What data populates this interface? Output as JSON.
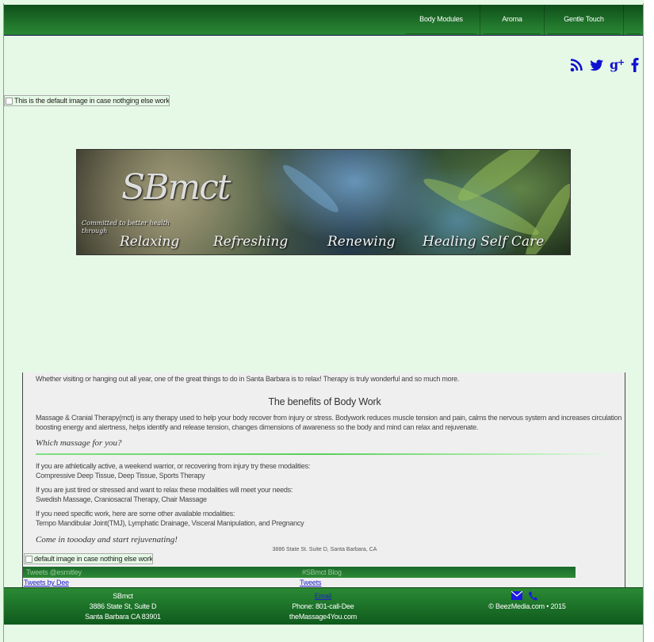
{
  "nav": {
    "items": [
      {
        "label": "Body Modules"
      },
      {
        "label": "Aroma"
      },
      {
        "label": "Gentle Touch"
      },
      {
        "label": ""
      }
    ]
  },
  "social": {
    "icons": [
      "rss-icon",
      "twitter-icon",
      "google-plus-icon",
      "facebook-icon"
    ],
    "color": "#1010d0"
  },
  "default_image_alt": "This is the default image in case nothging else works",
  "banner": {
    "logo": "SBmct",
    "tagline": "Committed to better health through",
    "words": [
      "Relaxing",
      "Refreshing",
      "Renewing",
      "Healing Self Care"
    ]
  },
  "content": {
    "intro": "Whether visiting or hanging out all year, one of the great things to do in Santa Barbara is to relax! Therapy is truly wonderful and so much more.",
    "heading": "The benefits of Body Work",
    "body_line1": "Massage & Cranial Therapy(mct) is any therapy used to help your body recover from injury or stress. Bodywork reduces muscle tension and pain, calms the nervous system and increases circulation",
    "body_line2": "boosting energy and alertness, helps identify and release tension, changes dimensions of awareness so the body and mind can relax and rejuvenate.",
    "subheading": "Which massage for you?",
    "p1_line1": "If you are athletically active, a weekend warrior, or recovering from injury try these modalities:",
    "p1_line2": "Compressive Deep Tissue, Deep Tissue, Sports Therapy",
    "p2_line1": "If you are just tired or stressed and want to relax these modalities will meet your needs:",
    "p2_line2": "Swedish Massage, Craniosacral Therapy, Chair Massage",
    "p3_line1": "If you need specific work, here are some other available modalities:",
    "p3_line2": "Tempo Mandibular Joint(TMJ), Lymphatic Drainage, Visceral Manipulation, and Pregnancy",
    "cta": "Come in toooday and start rejuvenating!",
    "address": "3886 State St. Suite D, Santa Barbara, CA",
    "small_image_alt": "default image in case nothing else works"
  },
  "tweets": {
    "left_title": "Tweets @esmitley",
    "left_link": "Tweets by Dee",
    "right_title": "#SBmct Blog",
    "right_link": "Tweets"
  },
  "footer": {
    "name": "SBmct",
    "street": "3886 State St, Suite D",
    "city": "Santa Barbara CA 83901",
    "email_link": "Email",
    "phone": "Phone: 801-call-Dee",
    "site": "theMassage4You.com",
    "copyright": "© BeezMedia.com • 2015"
  }
}
